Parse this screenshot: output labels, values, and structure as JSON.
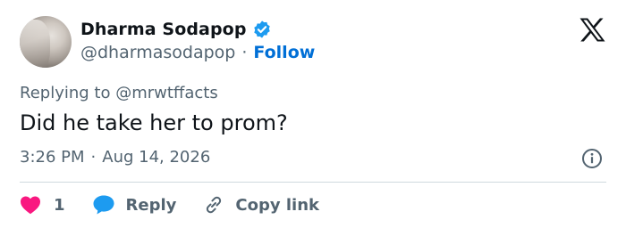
{
  "user": {
    "display_name": "Dharma Sodapop",
    "handle": "@dharmasodapop",
    "separator": "·",
    "follow_label": "Follow",
    "verified": true
  },
  "reply_context": {
    "prefix": "Replying to",
    "target": "@mrwtffacts"
  },
  "tweet": {
    "text": "Did he take her to prom?",
    "time": "3:26 PM",
    "separator": "·",
    "date": "Aug 14, 2026"
  },
  "actions": {
    "like_count": "1",
    "reply_label": "Reply",
    "copy_link_label": "Copy link"
  },
  "icons": {
    "verified": "verified-badge-icon",
    "brand": "x-logo-icon",
    "info": "info-icon",
    "like": "heart-icon",
    "reply": "speech-bubble-icon",
    "copy": "link-icon"
  },
  "colors": {
    "text": "#0f1419",
    "secondary": "#536471",
    "link_blue": "#006fd6",
    "verified_blue": "#1d9bf0",
    "like_pink": "#f91880",
    "divider": "#cfd9de"
  }
}
